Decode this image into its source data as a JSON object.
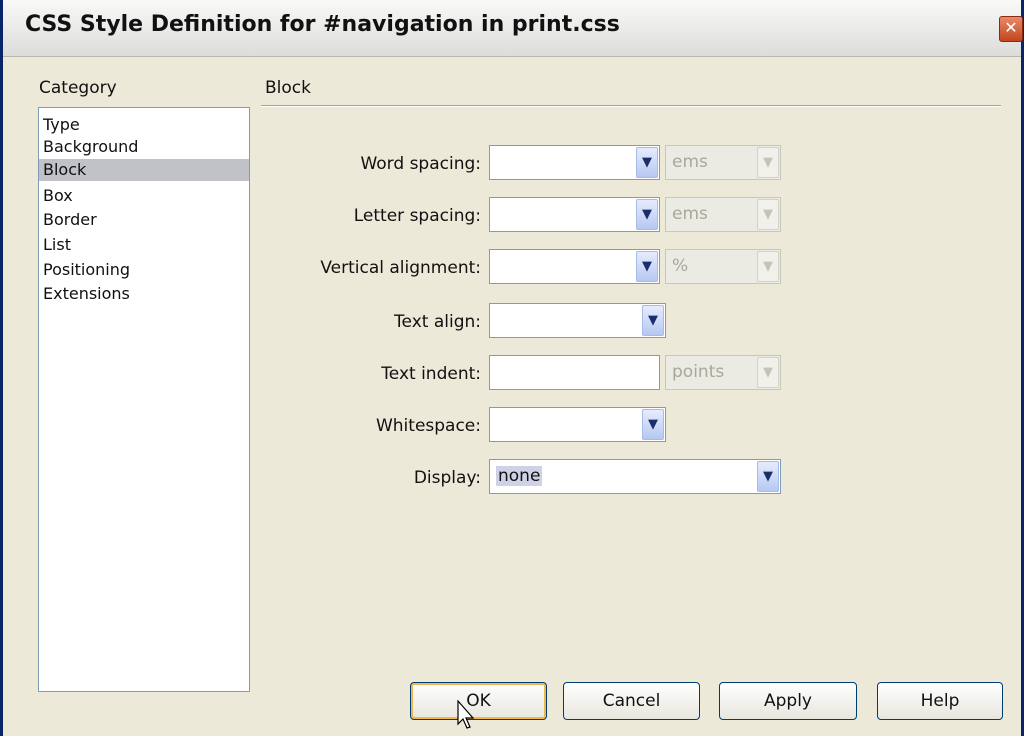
{
  "window": {
    "title": "CSS Style Definition for #navigation in print.css",
    "close_glyph": "✕"
  },
  "category": {
    "heading": "Category",
    "items": [
      {
        "label": "Type"
      },
      {
        "label": "Background"
      },
      {
        "label": "Block",
        "selected": true
      },
      {
        "label": "Box"
      },
      {
        "label": "Border"
      },
      {
        "label": "List"
      },
      {
        "label": "Positioning"
      },
      {
        "label": "Extensions"
      }
    ]
  },
  "panel": {
    "heading": "Block",
    "fields": {
      "word_spacing": {
        "label": "Word spacing:",
        "value": "",
        "unit": "ems",
        "unit_enabled": false
      },
      "letter_spacing": {
        "label": "Letter spacing:",
        "value": "",
        "unit": "ems",
        "unit_enabled": false
      },
      "vertical_alignment": {
        "label": "Vertical alignment:",
        "value": "",
        "unit": "%",
        "unit_enabled": false
      },
      "text_align": {
        "label": "Text align:",
        "value": ""
      },
      "text_indent": {
        "label": "Text indent:",
        "value": "",
        "unit": "points",
        "unit_enabled": false
      },
      "whitespace": {
        "label": "Whitespace:",
        "value": ""
      },
      "display": {
        "label": "Display:",
        "value": "none"
      }
    }
  },
  "buttons": {
    "ok": "OK",
    "cancel": "Cancel",
    "apply": "Apply",
    "help": "Help"
  },
  "icons": {
    "dropdown": "chevron-down-icon",
    "close": "close-icon",
    "cursor": "mouse-pointer-icon"
  },
  "colors": {
    "title_bar_border": "#0a246a",
    "selection": "#c1c1c8",
    "default_button_glow": "#f0b84c"
  }
}
